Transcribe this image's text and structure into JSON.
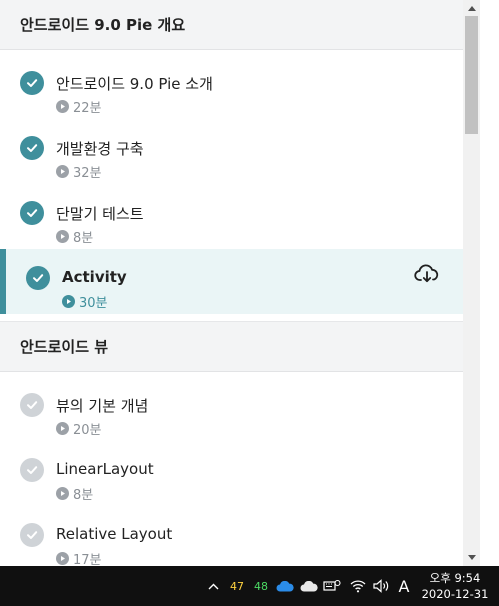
{
  "sections": [
    {
      "title": "안드로이드 9.0 Pie 개요",
      "lessons": [
        {
          "title": "안드로이드 9.0 Pie 소개",
          "duration": "22분",
          "done": true
        },
        {
          "title": "개발환경 구축",
          "duration": "32분",
          "done": true
        },
        {
          "title": "단말기 테스트",
          "duration": "8분",
          "done": true
        },
        {
          "title": "Activity",
          "duration": "30분",
          "done": true,
          "active": true
        }
      ]
    },
    {
      "title": "안드로이드 뷰",
      "lessons": [
        {
          "title": "뷰의 기본 개념",
          "duration": "20분",
          "done": false
        },
        {
          "title": "LinearLayout",
          "duration": "8분",
          "done": false
        },
        {
          "title": "Relative Layout",
          "duration": "17분",
          "done": false
        }
      ]
    }
  ],
  "taskbar": {
    "tray_num_1": "47",
    "tray_num_2": "48",
    "ime": "A",
    "time": "오후 9:54",
    "date": "2020-12-31"
  },
  "colors": {
    "accent": "#3f8f9c",
    "active_bg": "#eaf5f6",
    "tray_yellow": "#ffd23f",
    "tray_green": "#4cd964"
  }
}
